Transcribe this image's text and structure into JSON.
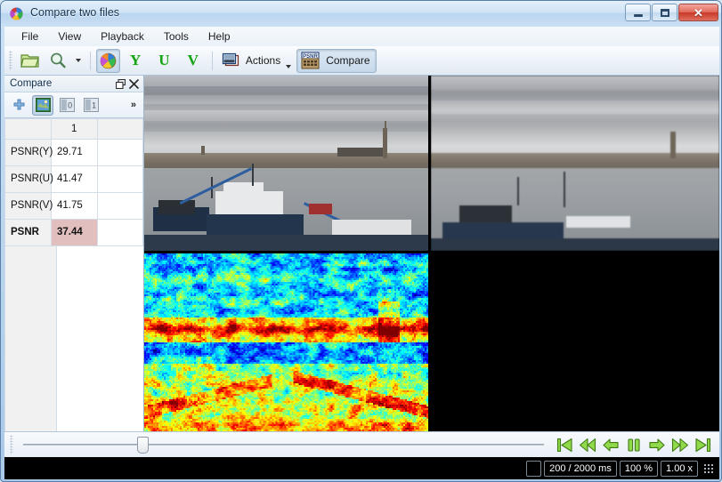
{
  "window": {
    "title": "Compare two files",
    "app_icon": "color-wheel-icon",
    "buttons": {
      "minimize": "minimize",
      "maximize": "maximize",
      "close": "close"
    }
  },
  "menubar": {
    "items": [
      {
        "label": "File"
      },
      {
        "label": "View"
      },
      {
        "label": "Playback"
      },
      {
        "label": "Tools"
      },
      {
        "label": "Help"
      }
    ]
  },
  "toolbar": {
    "open_label": "",
    "zoom_label": "",
    "color_label": "",
    "y_label": "Y",
    "u_label": "U",
    "v_label": "V",
    "actions_label": "Actions",
    "compare_label": "Compare",
    "compare_badge": "PSNR"
  },
  "dock": {
    "title": "Compare",
    "float_label": "",
    "close_label": "",
    "tools": {
      "add_label": "",
      "view_both_label": "",
      "view_0_label": "0",
      "view_1_label": "1",
      "overflow_label": "»"
    },
    "table": {
      "headers": [
        "",
        "1",
        ""
      ],
      "rows": [
        {
          "label": "PSNR(Y)",
          "value": "29.71",
          "highlight": false,
          "bold": false
        },
        {
          "label": "PSNR(U)",
          "value": "41.47",
          "highlight": false,
          "bold": false
        },
        {
          "label": "PSNR(V)",
          "value": "41.75",
          "highlight": false,
          "bold": false
        },
        {
          "label": "PSNR",
          "value": "37.44",
          "highlight": true,
          "bold": true
        }
      ]
    }
  },
  "viewport": {
    "tiles": [
      {
        "name": "reference-video-frame",
        "kind": "photo"
      },
      {
        "name": "compared-video-frame",
        "kind": "photo-blurred"
      },
      {
        "name": "difference-heatmap",
        "kind": "heatmap"
      }
    ]
  },
  "seekbar": {
    "position_percent": 17
  },
  "playback": {
    "buttons": [
      {
        "name": "go-to-start-button",
        "icon": "skip-start-icon"
      },
      {
        "name": "rewind-button",
        "icon": "rewind-icon"
      },
      {
        "name": "step-back-button",
        "icon": "arrow-left-icon"
      },
      {
        "name": "pause-button",
        "icon": "pause-icon"
      },
      {
        "name": "step-forward-button",
        "icon": "arrow-right-icon"
      },
      {
        "name": "fast-forward-button",
        "icon": "fast-forward-icon"
      },
      {
        "name": "go-to-end-button",
        "icon": "skip-end-icon"
      }
    ]
  },
  "statusbar": {
    "indicator": "",
    "time": "200 / 2000 ms",
    "zoom": "100 %",
    "speed": "1.00 x"
  },
  "colors": {
    "accent_green": "#16a416",
    "highlight_cell": "#e2bfbf",
    "title_blue": "#17324d"
  }
}
